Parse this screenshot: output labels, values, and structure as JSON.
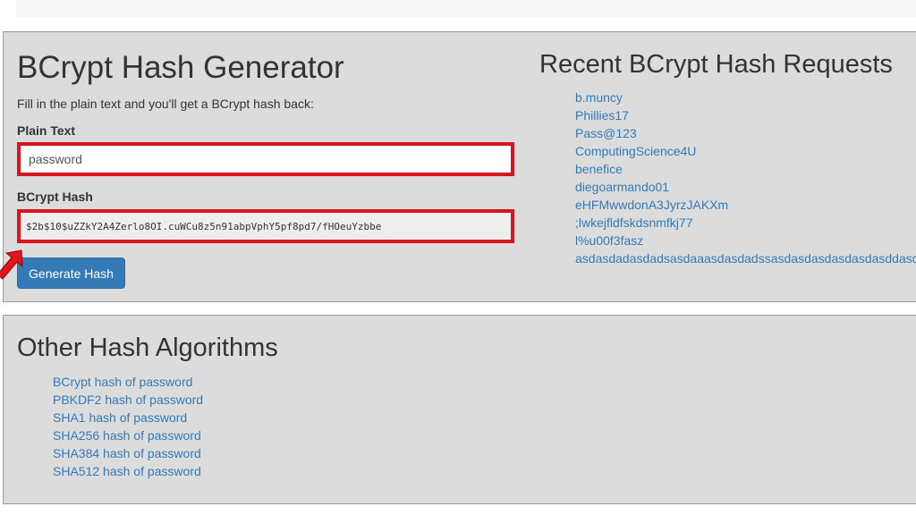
{
  "generator": {
    "title": "BCrypt Hash Generator",
    "intro": "Fill in the plain text and you'll get a BCrypt hash back:",
    "plain_label": "Plain Text",
    "plain_value": "password",
    "hash_label": "BCrypt Hash",
    "hash_value": "$2b$10$uZZkY2A4Zerlo8OI.cuWCu8z5n91abpVphY5pf8pd7/fHOeuYzbbe",
    "button_label": "Generate Hash"
  },
  "recent": {
    "title": "Recent BCrypt Hash Requests",
    "items": [
      "b.muncy",
      "Phillies17",
      "Pass@123",
      "ComputingScience4U",
      "benefice",
      "diegoarmando01",
      "eHFMwwdonA3JyrzJAKXm",
      ";lwkejfldfskdsnmfkj77",
      "l%u00f3fasz",
      "asdasdadasdadsasdaaasdasdadssasdasdasdasdasdasddasd"
    ]
  },
  "other": {
    "title": "Other Hash Algorithms",
    "items": [
      "BCrypt hash of password",
      "PBKDF2 hash of password",
      "SHA1 hash of password",
      "SHA256 hash of password",
      "SHA384 hash of password",
      "SHA512 hash of password"
    ]
  },
  "colors": {
    "link": "#337ab7",
    "button": "#337ab7",
    "highlight": "#d8141c",
    "panel": "#dcdcdc"
  },
  "icons": {
    "annotation": "red-arrow-icon"
  }
}
